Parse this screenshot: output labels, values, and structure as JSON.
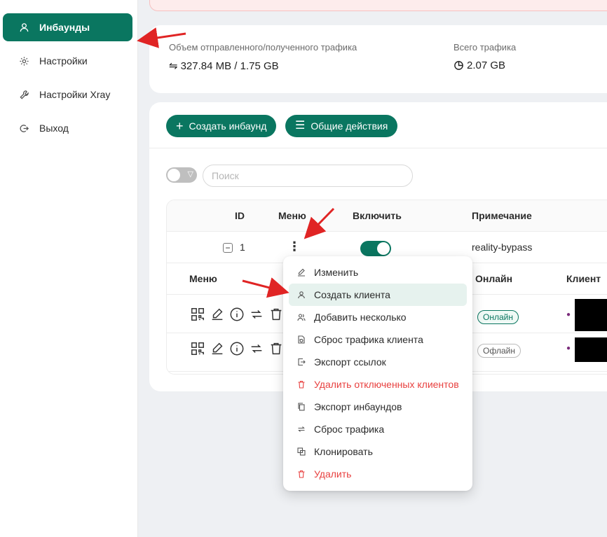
{
  "sidebar": {
    "items": [
      {
        "label": "Инбаунды",
        "icon": "user-icon",
        "active": true
      },
      {
        "label": "Настройки",
        "icon": "gear-icon",
        "active": false
      },
      {
        "label": "Настройки Xray",
        "icon": "wrench-icon",
        "active": false
      },
      {
        "label": "Выход",
        "icon": "logout-icon",
        "active": false
      }
    ]
  },
  "stats": {
    "traffic_label": "Объем отправленного/полученного трафика",
    "traffic_value": "327.84 MB / 1.75 GB",
    "total_label": "Всего трафика",
    "total_value": "2.07 GB"
  },
  "toolbar": {
    "create_label": "Создать инбаунд",
    "general_label": "Общие действия"
  },
  "search": {
    "placeholder": "Поиск"
  },
  "table": {
    "headers": {
      "id": "ID",
      "menu": "Меню",
      "enable": "Включить",
      "note": "Примечание"
    },
    "row": {
      "id": "1",
      "enabled": true,
      "note": "reality-bypass"
    }
  },
  "clients": {
    "headers": {
      "menu": "Меню",
      "online": "Онлайн",
      "client": "Клиент"
    },
    "rows": [
      {
        "status": "Онлайн",
        "online": true
      },
      {
        "status": "Офлайн",
        "online": false
      }
    ]
  },
  "menu": {
    "items": [
      {
        "label": "Изменить",
        "icon": "edit-icon",
        "danger": false
      },
      {
        "label": "Создать клиента",
        "icon": "user-icon",
        "danger": false
      },
      {
        "label": "Добавить несколько",
        "icon": "users-icon",
        "danger": false
      },
      {
        "label": "Сброс трафика клиента",
        "icon": "file-reset-icon",
        "danger": false
      },
      {
        "label": "Экспорт ссылок",
        "icon": "export-icon",
        "danger": false
      },
      {
        "label": "Удалить отключенных клиентов",
        "icon": "trash-icon",
        "danger": true
      },
      {
        "label": "Экспорт инбаундов",
        "icon": "copy-icon",
        "danger": false
      },
      {
        "label": "Сброс трафика",
        "icon": "retweet-icon",
        "danger": false
      },
      {
        "label": "Клонировать",
        "icon": "clone-icon",
        "danger": false
      },
      {
        "label": "Удалить",
        "icon": "trash-icon",
        "danger": true
      }
    ]
  },
  "colors": {
    "accent": "#0a7660",
    "danger": "#e8403f",
    "arrow": "#e02424"
  }
}
